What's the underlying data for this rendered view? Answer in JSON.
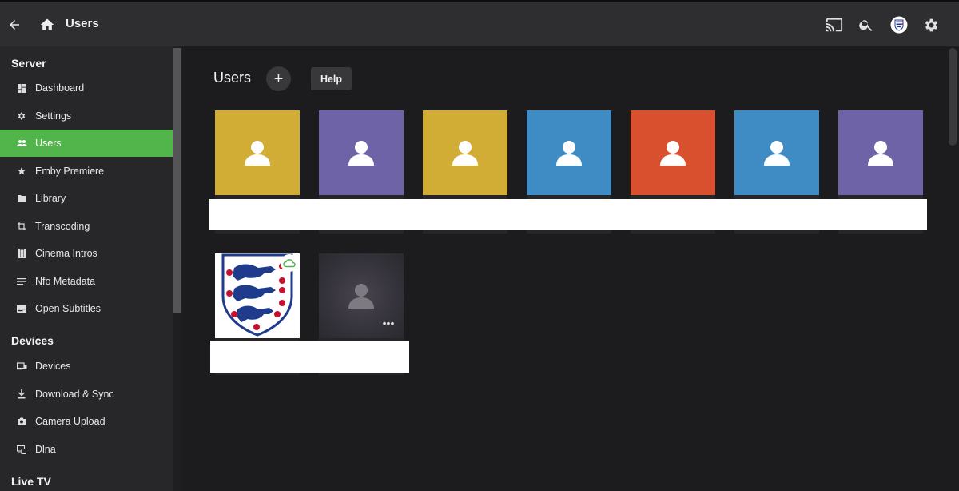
{
  "header": {
    "title": "Users",
    "icons": [
      "back-arrow-icon",
      "home-icon",
      "cast-icon",
      "search-icon",
      "user-avatar",
      "gear-icon"
    ]
  },
  "sidebar": {
    "sections": [
      {
        "title": "Server",
        "items": [
          {
            "label": "Dashboard",
            "icon": "dashboard-icon"
          },
          {
            "label": "Settings",
            "icon": "gear-icon"
          },
          {
            "label": "Users",
            "icon": "people-icon",
            "active": true
          },
          {
            "label": "Emby Premiere",
            "icon": "star-icon"
          },
          {
            "label": "Library",
            "icon": "folder-icon"
          },
          {
            "label": "Transcoding",
            "icon": "transcode-icon"
          },
          {
            "label": "Cinema Intros",
            "icon": "film-icon"
          },
          {
            "label": "Nfo Metadata",
            "icon": "lines-icon"
          },
          {
            "label": "Open Subtitles",
            "icon": "subtitles-icon"
          }
        ]
      },
      {
        "title": "Devices",
        "items": [
          {
            "label": "Devices",
            "icon": "devices-icon"
          },
          {
            "label": "Download & Sync",
            "icon": "download-icon"
          },
          {
            "label": "Camera Upload",
            "icon": "camera-icon"
          },
          {
            "label": "Dlna",
            "icon": "dlna-icon"
          }
        ]
      },
      {
        "title": "Live TV",
        "items": []
      }
    ]
  },
  "main": {
    "title": "Users",
    "add_label": "+",
    "help_label": "Help",
    "user_cards_row1": [
      {
        "color": "#d1ad35"
      },
      {
        "color": "#6e63a6"
      },
      {
        "color": "#d1ad35"
      },
      {
        "color": "#3f8cc4"
      },
      {
        "color": "#d9502f"
      },
      {
        "color": "#3f8cc4"
      },
      {
        "color": "#6e63a6"
      }
    ],
    "more_label": "•••"
  },
  "colors": {
    "accent": "#52b54b",
    "header_bg": "#2e2e30",
    "sidebar_bg": "#27272a",
    "main_bg": "#1c1c1e"
  }
}
